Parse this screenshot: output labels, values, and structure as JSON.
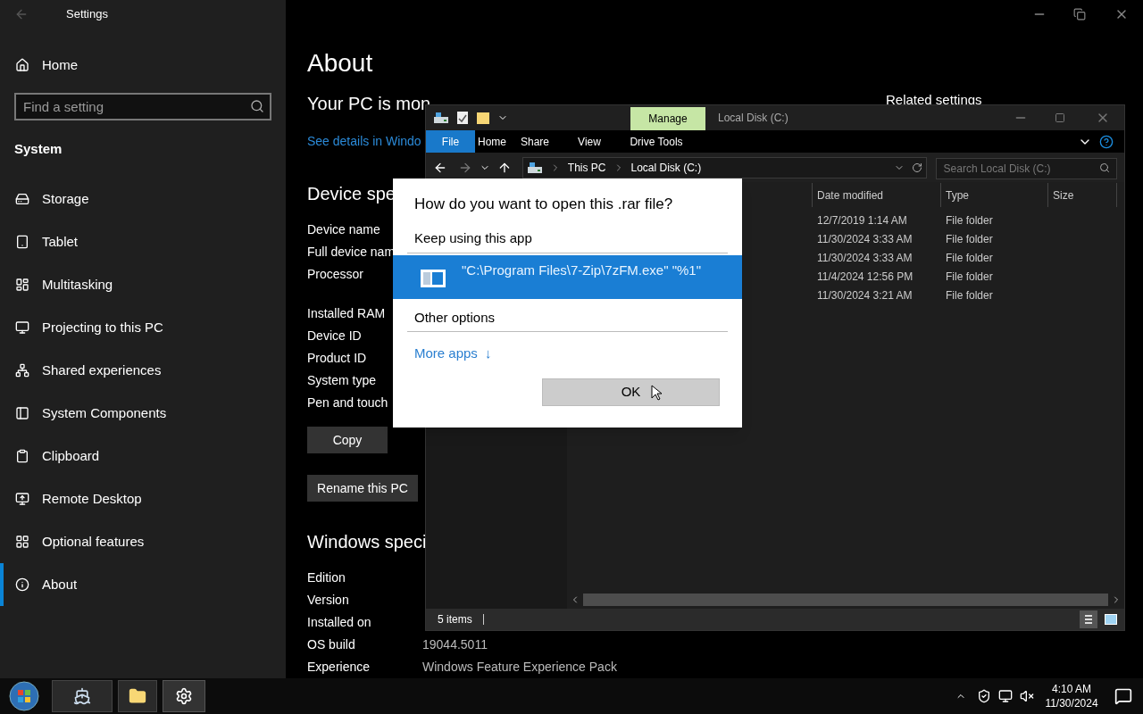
{
  "settings": {
    "title": "Settings",
    "home": "Home",
    "search_placeholder": "Find a setting",
    "section": "System",
    "nav_items": [
      {
        "label": "Storage",
        "selected": false
      },
      {
        "label": "Tablet",
        "selected": false
      },
      {
        "label": "Multitasking",
        "selected": false
      },
      {
        "label": "Projecting to this PC",
        "selected": false
      },
      {
        "label": "Shared experiences",
        "selected": false
      },
      {
        "label": "System Components",
        "selected": false
      },
      {
        "label": "Clipboard",
        "selected": false
      },
      {
        "label": "Remote Desktop",
        "selected": false
      },
      {
        "label": "Optional features",
        "selected": false
      },
      {
        "label": "About",
        "selected": true
      }
    ],
    "page": {
      "title": "About",
      "protection_heading": "Your PC is mon",
      "details_link": "See details in Windo",
      "related_heading": "Related settings",
      "device_heading": "Device spe",
      "device_specs": [
        [
          "Device name",
          "Full device nam",
          "Processor"
        ],
        [
          "Installed RAM",
          "Device ID",
          "Product ID",
          "System type",
          "Pen and touch"
        ]
      ],
      "buttons": [
        "Copy",
        "Rename this PC"
      ],
      "windows_heading": "Windows speci",
      "windows_specs": [
        {
          "label": "Edition"
        },
        {
          "label": "Version"
        },
        {
          "label": "Installed on"
        },
        {
          "label": "OS build",
          "value": "19044.5011"
        },
        {
          "label": "Experience",
          "value": "Windows Feature Experience Pack"
        }
      ]
    }
  },
  "explorer": {
    "context_tab": "Manage",
    "title": "Local Disk (C:)",
    "file_menu": "File",
    "ribbon_tabs": [
      "Home",
      "Share",
      "View",
      "Drive Tools"
    ],
    "breadcrumb": [
      "This PC",
      "Local Disk (C:)"
    ],
    "search_placeholder": "Search Local Disk (C:)",
    "columns": [
      "Date modified",
      "Type",
      "Size"
    ],
    "rows": [
      {
        "date": "12/7/2019 1:14 AM",
        "type": "File folder"
      },
      {
        "date": "11/30/2024 3:33 AM",
        "type": "File folder"
      },
      {
        "date": "11/30/2024 3:33 AM",
        "type": "File folder"
      },
      {
        "date": "11/4/2024 12:56 PM",
        "type": "File folder"
      },
      {
        "date": "11/30/2024 3:21 AM",
        "type": "File folder"
      }
    ],
    "status": "5 items"
  },
  "dialog": {
    "title": "How do you want to open this .rar file?",
    "keep_heading": "Keep using this app",
    "apps": [
      {
        "label": "\"C:\\Program Files\\7-Zip\\7zFM.exe\" \"%1\"",
        "selected": true
      }
    ],
    "other_heading": "Other options",
    "more_link": "More apps",
    "more_arrow": "↓",
    "ok": "OK"
  },
  "taskbar": {
    "time": "4:10 AM",
    "date": "11/30/2024"
  }
}
